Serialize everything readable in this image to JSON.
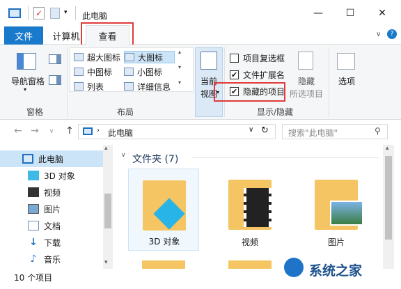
{
  "window": {
    "title": "此电脑",
    "minimize_glyph": "—",
    "maximize_glyph": "☐",
    "close_glyph": "✕"
  },
  "tabs": {
    "file": "文件",
    "computer": "计算机",
    "view": "查看"
  },
  "ribbon": {
    "panes": {
      "nav_pane_label": "导航窗格",
      "group_label": "窗格"
    },
    "layout": {
      "items": [
        "超大图标",
        "大图标",
        "中图标",
        "小图标",
        "列表",
        "详细信息"
      ],
      "selected": "大图标",
      "group_label": "布局"
    },
    "current_view": {
      "label_line1": "当前",
      "label_line2": "视图"
    },
    "show_hide": {
      "item_checkboxes": "项目复选框",
      "file_extensions": "文件扩展名",
      "hidden_items": "隐藏的项目",
      "item_checkboxes_checked": false,
      "file_extensions_checked": true,
      "hidden_items_checked": true,
      "hide_label_line1": "隐藏",
      "hide_label_line2": "所选项目",
      "group_label": "显示/隐藏"
    },
    "options_label": "选项"
  },
  "address": {
    "path": "此电脑",
    "search_placeholder": "搜索\"此电脑\""
  },
  "nav_pane": {
    "items": [
      "此电脑",
      "3D 对象",
      "视频",
      "图片",
      "文档",
      "下载",
      "音乐"
    ]
  },
  "content": {
    "group_header": "文件夹 (7)",
    "folders": [
      "3D 对象",
      "视频",
      "图片"
    ]
  },
  "status": {
    "item_count": "10 个项目"
  },
  "watermark": {
    "text": "系统之家"
  },
  "colors": {
    "file_tab": "#1979ca",
    "highlight_box": "#e03b3b",
    "folder": "#f4c562"
  }
}
